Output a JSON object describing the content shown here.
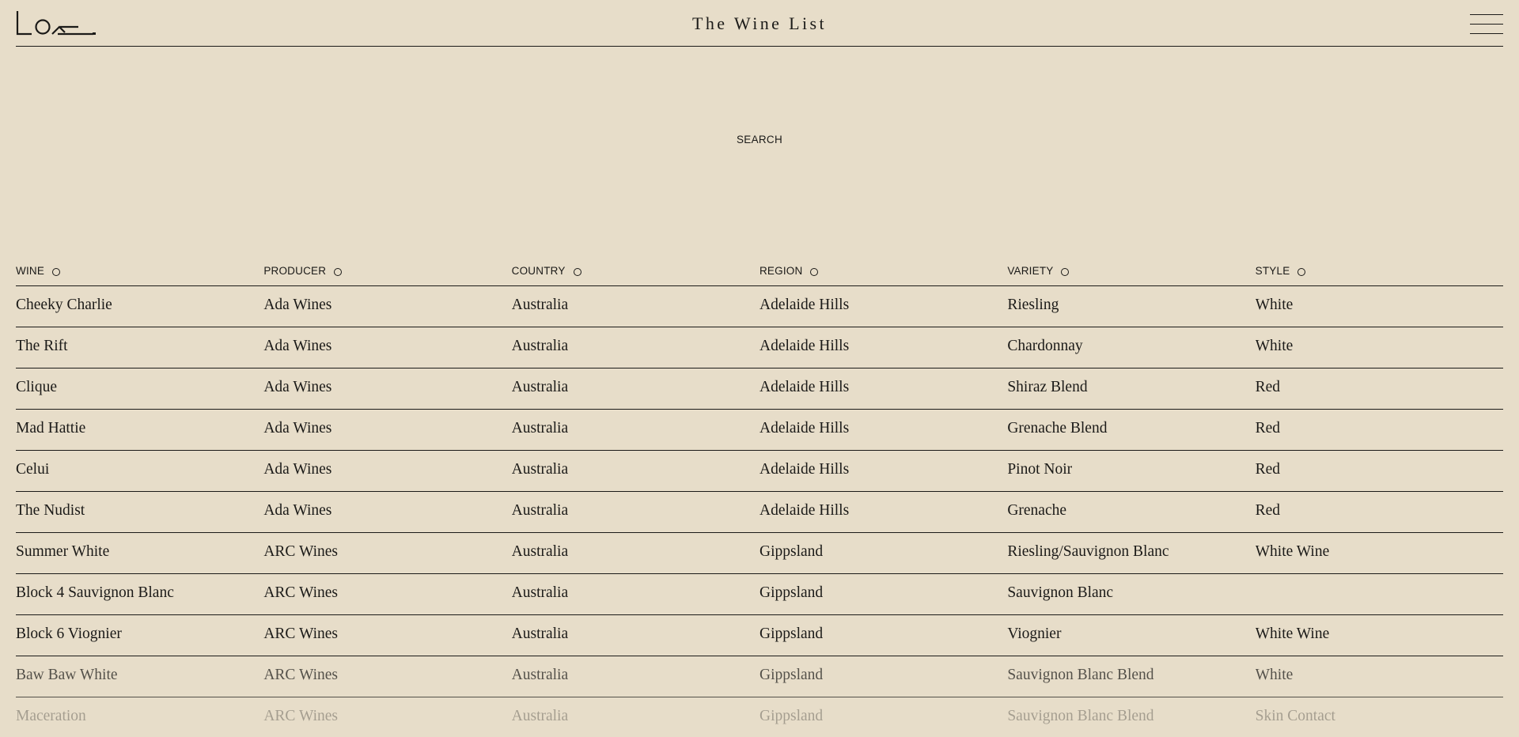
{
  "header": {
    "title": "The Wine List",
    "logo_icon": "loam-logo-icon",
    "menu_icon": "hamburger-menu-icon"
  },
  "search": {
    "label": "SEARCH"
  },
  "table": {
    "columns": [
      {
        "label": "WINE",
        "sort_icon": "sort-circle-icon"
      },
      {
        "label": "PRODUCER",
        "sort_icon": "sort-circle-icon"
      },
      {
        "label": "COUNTRY",
        "sort_icon": "sort-circle-icon"
      },
      {
        "label": "REGION",
        "sort_icon": "sort-circle-icon"
      },
      {
        "label": "VARIETY",
        "sort_icon": "sort-circle-icon"
      },
      {
        "label": "STYLE",
        "sort_icon": "sort-circle-icon"
      }
    ],
    "rows": [
      [
        "Cheeky Charlie",
        "Ada Wines",
        "Australia",
        "Adelaide Hills",
        "Riesling",
        "White"
      ],
      [
        "The Rift",
        "Ada Wines",
        "Australia",
        "Adelaide Hills",
        "Chardonnay",
        "White"
      ],
      [
        "Clique",
        "Ada Wines",
        "Australia",
        "Adelaide Hills",
        "Shiraz Blend",
        "Red"
      ],
      [
        "Mad Hattie",
        "Ada Wines",
        "Australia",
        "Adelaide Hills",
        "Grenache Blend",
        "Red"
      ],
      [
        "Celui",
        "Ada Wines",
        "Australia",
        "Adelaide Hills",
        "Pinot Noir",
        "Red"
      ],
      [
        "The Nudist",
        "Ada Wines",
        "Australia",
        "Adelaide Hills",
        "Grenache",
        "Red"
      ],
      [
        "Summer White",
        "ARC Wines",
        "Australia",
        "Gippsland",
        "Riesling/Sauvignon Blanc",
        "White Wine"
      ],
      [
        "Block 4 Sauvignon Blanc",
        "ARC Wines",
        "Australia",
        "Gippsland",
        "Sauvignon Blanc",
        ""
      ],
      [
        "Block 6 Viognier",
        "ARC Wines",
        "Australia",
        "Gippsland",
        "Viognier",
        "White Wine"
      ],
      [
        "Baw Baw White",
        "ARC Wines",
        "Australia",
        "Gippsland",
        "Sauvignon Blanc Blend",
        "White"
      ],
      [
        "Maceration",
        "ARC Wines",
        "Australia",
        "Gippsland",
        "Sauvignon Blanc Blend",
        "Skin Contact"
      ]
    ]
  }
}
